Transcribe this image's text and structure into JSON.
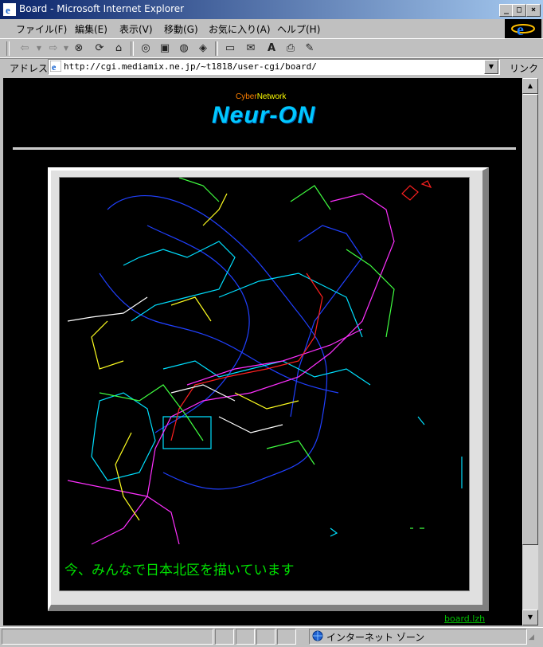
{
  "window": {
    "title": "Board - Microsoft Internet Explorer",
    "controls": [
      "_",
      "□",
      "×"
    ]
  },
  "menu": [
    "ファイル(F)",
    "編集(E)",
    "表示(V)",
    "移動(G)",
    "お気に入り(A)",
    "ヘルプ(H)"
  ],
  "address": {
    "label": "アドレス",
    "url": "http://cgi.mediamix.ne.jp/~t1818/user-cgi/board/",
    "links_label": "リンク"
  },
  "page": {
    "brand_small_a": "Cyber",
    "brand_small_b": "Network",
    "brand_big": "Neur-ON",
    "drawing_caption": "今、みんなで日本北区を描いています",
    "file_link": "board.lzh"
  },
  "status": {
    "zone": "インターネット ゾーン"
  },
  "colors": {
    "brand_a": "#ff8000",
    "brand_b": "#ffff00",
    "brand_big": "#00c8ff",
    "caption": "#00e000",
    "link": "#00c000"
  },
  "icons": [
    "back-icon",
    "forward-icon",
    "stop-icon",
    "refresh-icon",
    "home-icon",
    "search-icon",
    "favorites-icon",
    "history-icon",
    "channels-icon",
    "fullscreen-icon",
    "mail-icon",
    "font-icon",
    "print-icon",
    "edit-icon"
  ]
}
